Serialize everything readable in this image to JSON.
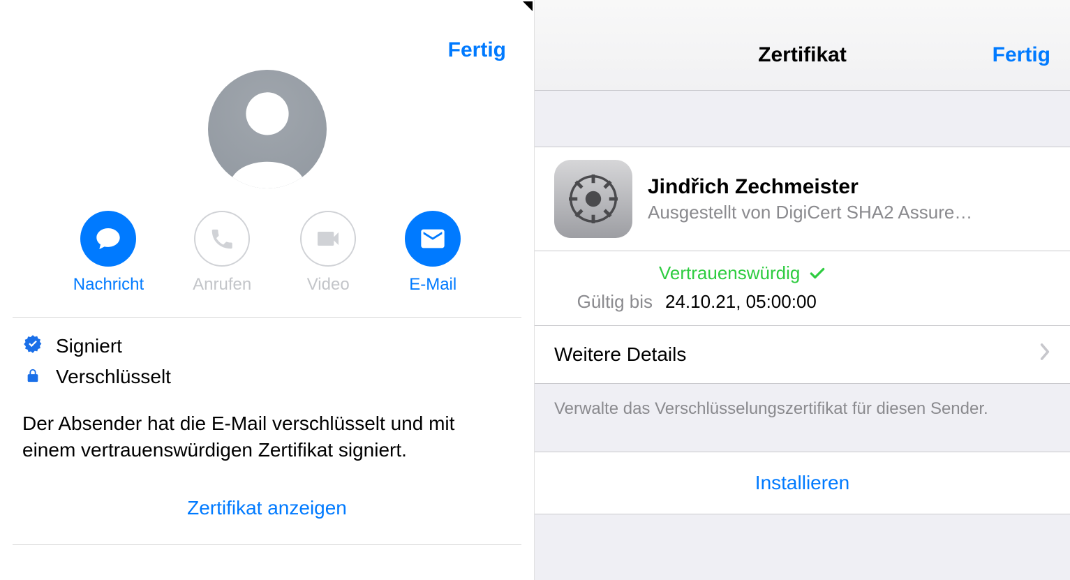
{
  "left": {
    "done": "Fertig",
    "actions": {
      "message": "Nachricht",
      "call": "Anrufen",
      "video": "Video",
      "email": "E-Mail"
    },
    "signed": "Signiert",
    "encrypted": "Verschlüsselt",
    "description": "Der Absender hat die E-Mail verschlüsselt und mit einem vertrauenswürdigen Zertifikat signiert.",
    "show_cert": "Zertifikat anzeigen"
  },
  "right": {
    "title": "Zertifikat",
    "done": "Fertig",
    "cert": {
      "name": "Jindřich Zechmeister",
      "issuer": "Ausgestellt von DigiCert SHA2 Assure…",
      "trusted": "Vertrauenswürdig",
      "valid_key": "Gültig bis",
      "valid_val": "24.10.21, 05:00:00"
    },
    "more": "Weitere Details",
    "footer": "Verwalte das Verschlüsselungszertifikat für diesen Sender.",
    "install": "Installieren"
  }
}
